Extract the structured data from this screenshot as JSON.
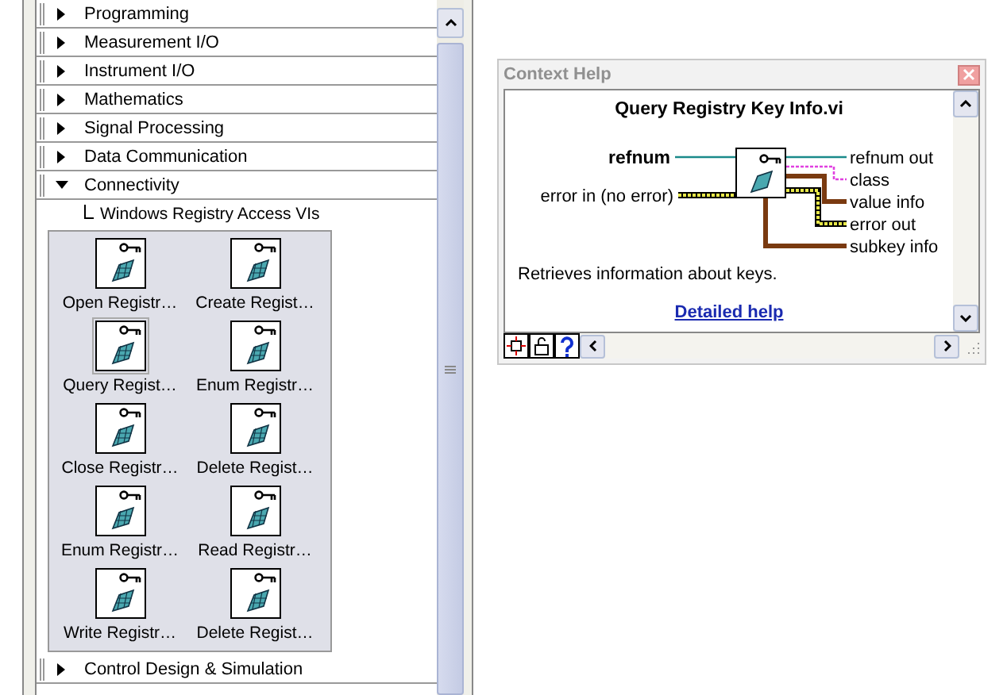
{
  "palette": {
    "categories": [
      {
        "label": "Programming",
        "expanded": false
      },
      {
        "label": "Measurement I/O",
        "expanded": false
      },
      {
        "label": "Instrument I/O",
        "expanded": false
      },
      {
        "label": "Mathematics",
        "expanded": false
      },
      {
        "label": "Signal Processing",
        "expanded": false
      },
      {
        "label": "Data Communication",
        "expanded": false
      },
      {
        "label": "Connectivity",
        "expanded": true,
        "subpalette": {
          "label": "Windows Registry Access VIs",
          "items": [
            {
              "label": "Open Registr…",
              "selected": false
            },
            {
              "label": "Create Regist…",
              "selected": false
            },
            {
              "label": "Query Regist…",
              "selected": true
            },
            {
              "label": "Enum Registr…",
              "selected": false
            },
            {
              "label": "Close Registr…",
              "selected": false
            },
            {
              "label": "Delete Regist…",
              "selected": false
            },
            {
              "label": "Enum Registr…",
              "selected": false
            },
            {
              "label": "Read Registr…",
              "selected": false
            },
            {
              "label": "Write Registr…",
              "selected": false
            },
            {
              "label": "Delete Regist…",
              "selected": false
            }
          ]
        }
      },
      {
        "label": "Control Design & Simulation",
        "expanded": false
      }
    ]
  },
  "context_help": {
    "title": "Context Help",
    "vi_name": "Query Registry Key Info.vi",
    "inputs": [
      {
        "label": "refnum",
        "kind": "required"
      },
      {
        "label": "error in (no error)",
        "kind": "recommended"
      }
    ],
    "outputs": [
      {
        "label": "refnum out"
      },
      {
        "label": "class"
      },
      {
        "label": "value info"
      },
      {
        "label": "error out"
      },
      {
        "label": "subkey info"
      }
    ],
    "description": "Retrieves information about keys.",
    "link": "Detailed help"
  }
}
